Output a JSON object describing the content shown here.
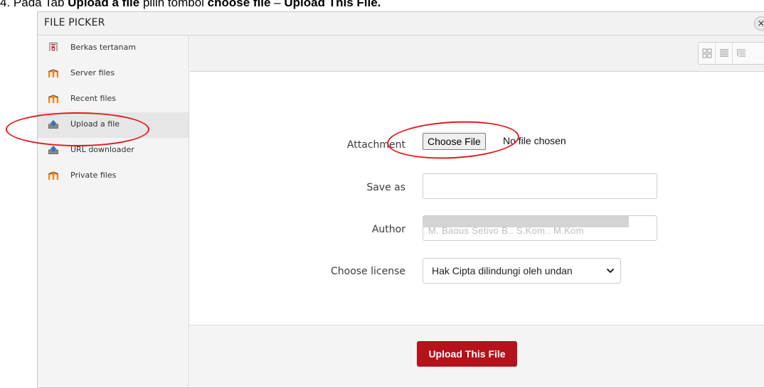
{
  "caption": {
    "prefix": "4.   Pada Tab ",
    "tab_name": "Upload a file",
    "middle": " pilih tombol ",
    "button1": "choose file",
    "sep": " – ",
    "button2": "Upload This File."
  },
  "window": {
    "title": "FILE PICKER",
    "close_glyph": "×"
  },
  "sidebar": {
    "items": [
      {
        "label": "Berkas tertanam",
        "icon": "file-embedded-icon",
        "active": false
      },
      {
        "label": "Server files",
        "icon": "moodle-icon",
        "active": false
      },
      {
        "label": "Recent files",
        "icon": "moodle-icon",
        "active": false
      },
      {
        "label": "Upload a file",
        "icon": "upload-icon",
        "active": true
      },
      {
        "label": "URL downloader",
        "icon": "upload-icon",
        "active": false
      },
      {
        "label": "Private files",
        "icon": "moodle-icon",
        "active": false
      }
    ]
  },
  "toolbar": {
    "views": [
      "icon-view-icon",
      "list-view-icon",
      "tree-view-icon"
    ]
  },
  "form": {
    "attachment_label": "Attachment",
    "choose_file_label": "Choose File",
    "no_file_text": "No file chosen",
    "saveas_label": "Save as",
    "saveas_value": "",
    "author_label": "Author",
    "author_value": "M. Bagus Setiyo B., S.Kom., M.Kom",
    "license_label": "Choose license",
    "license_value": "Hak Cipta dilindungi oleh undan"
  },
  "footer": {
    "upload_label": "Upload This File"
  },
  "colors": {
    "accent": "#b5121b",
    "annotation": "#e3171b",
    "moodle_orange": "#f98012"
  }
}
